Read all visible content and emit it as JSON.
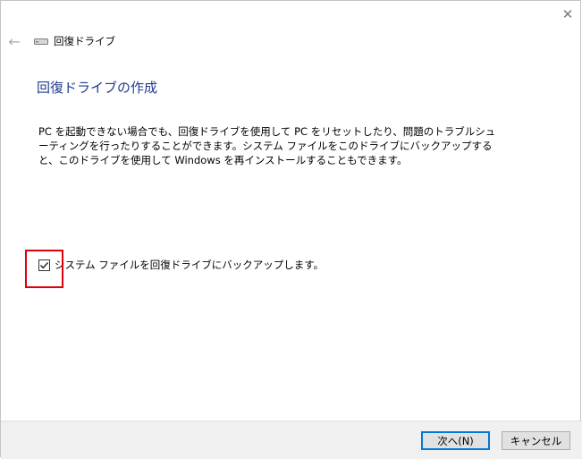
{
  "window": {
    "title": "回復ドライブ",
    "close_glyph": "✕",
    "back_glyph": "←"
  },
  "page": {
    "heading": "回復ドライブの作成",
    "description": "PC を起動できない場合でも、回復ドライブを使用して PC をリセットしたり、問題のトラブルシューティングを行ったりすることができます。システム ファイルをこのドライブにバックアップすると、このドライブを使用して Windows を再インストールすることもできます。",
    "backup_checkbox": {
      "label": "システム ファイルを回復ドライブにバックアップします。",
      "checked": true
    }
  },
  "footer": {
    "next_label": "次へ(N)",
    "cancel_label": "キャンセル"
  },
  "colors": {
    "heading": "#1e3c8c",
    "annotation": "#e0000c",
    "default_button_border": "#0078d7"
  }
}
